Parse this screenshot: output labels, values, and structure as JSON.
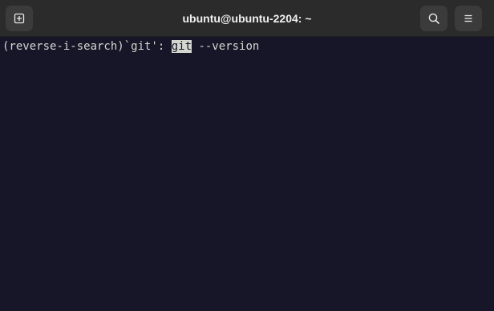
{
  "window": {
    "title": "ubuntu@ubuntu-2204: ~"
  },
  "toolbar": {
    "new_tab_icon": "new-tab-icon",
    "search_icon": "search-icon",
    "menu_icon": "hamburger-menu-icon"
  },
  "terminal": {
    "lines": [
      {
        "prefix": "(reverse-i-search)`git': ",
        "match": "git",
        "suffix": " --version"
      }
    ]
  },
  "colors": {
    "titlebar_bg": "#2b2b2b",
    "button_bg": "#3b3b3b",
    "terminal_bg": "#171628",
    "terminal_fg": "#d3d7cf",
    "title_fg": "#f0f0f0"
  }
}
